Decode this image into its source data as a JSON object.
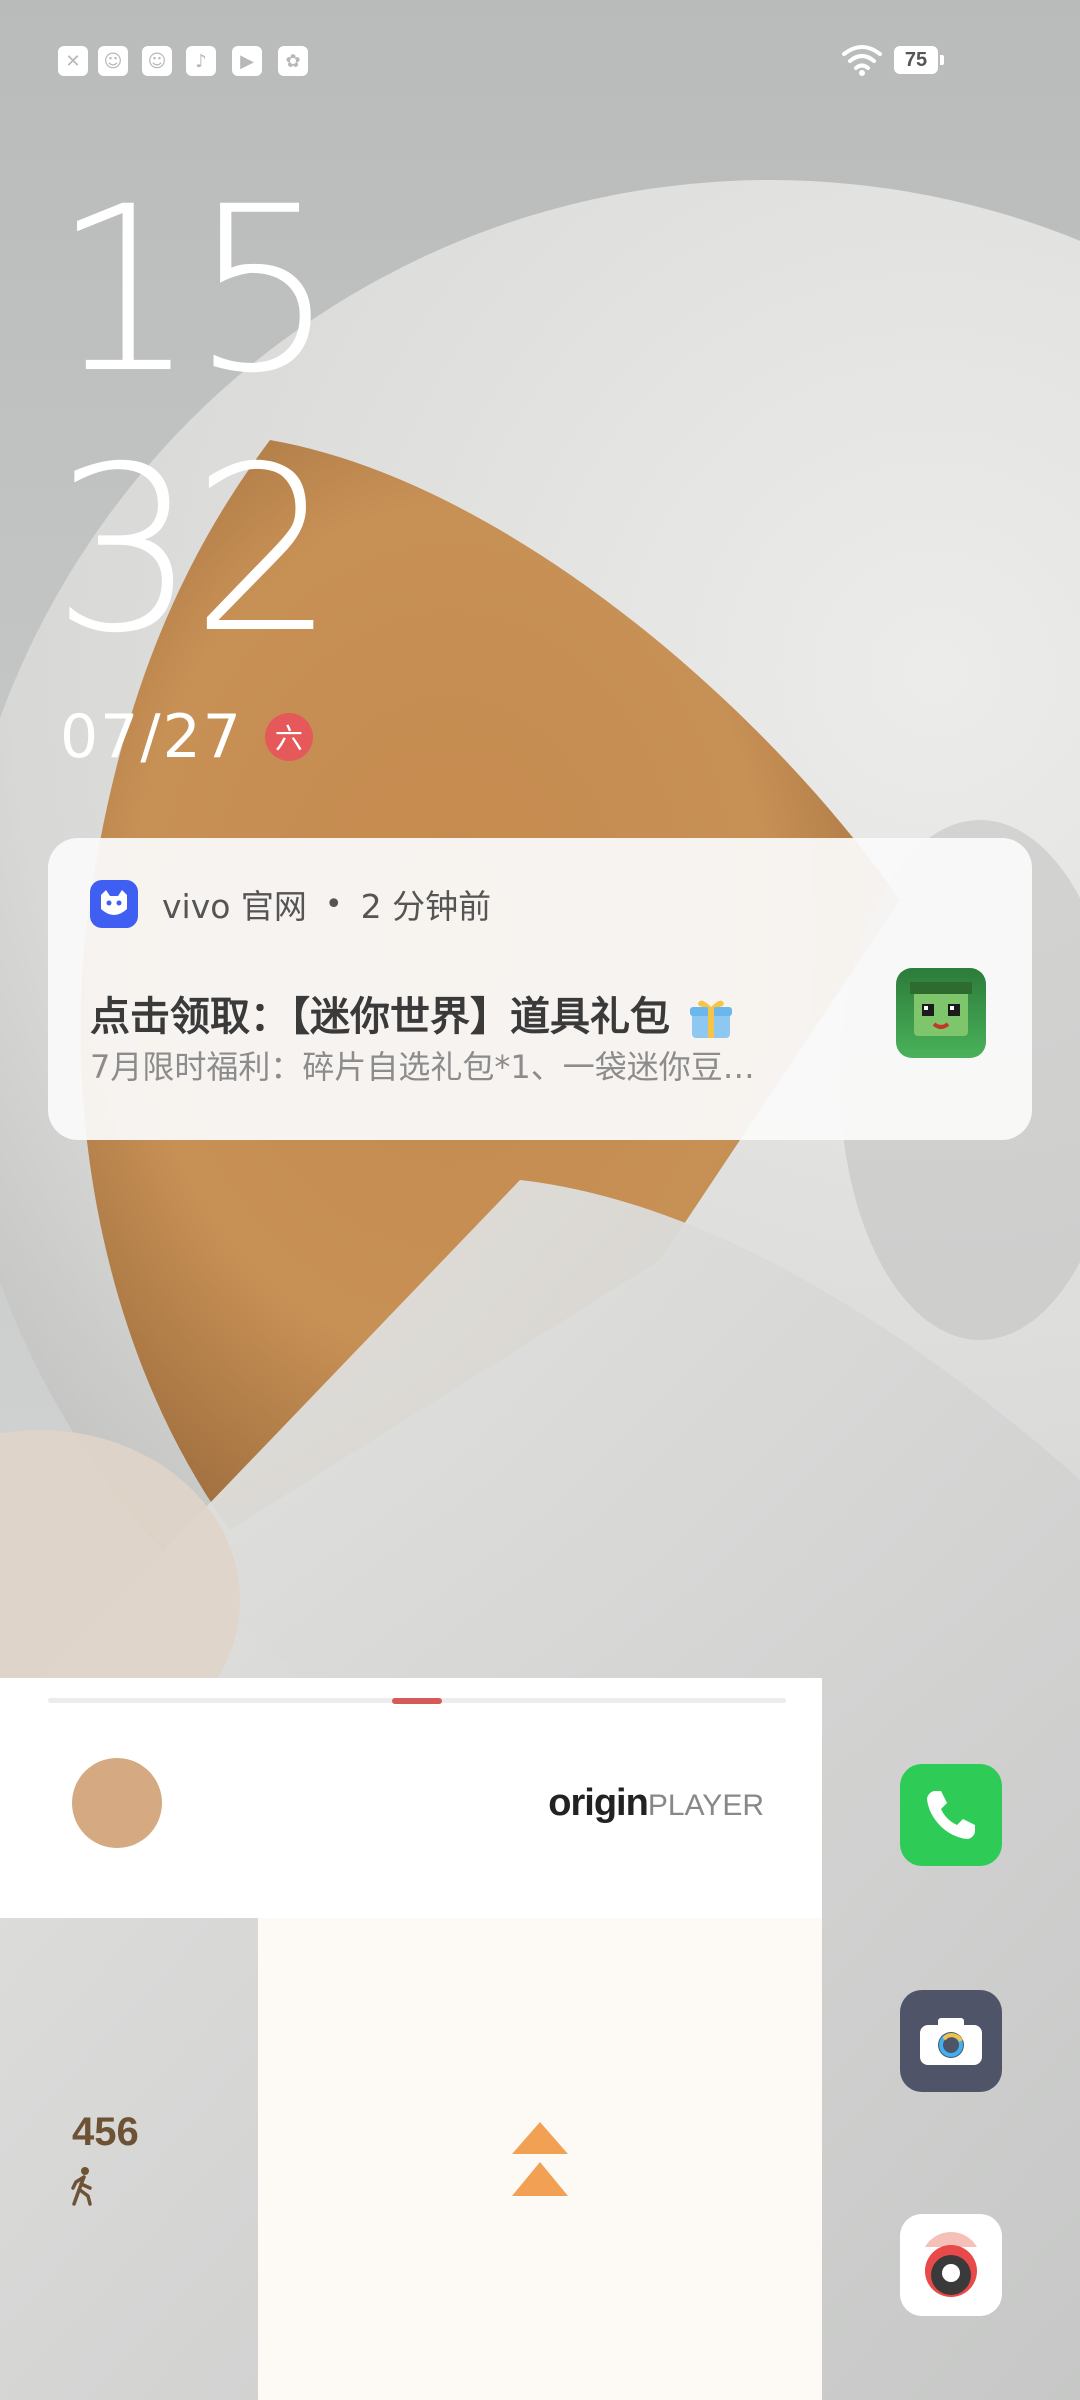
{
  "status_bar": {
    "left_icons": [
      "close-icon",
      "app-mascot-icon",
      "app-mascot-icon",
      "music-note-icon",
      "play-icon",
      "pinwheel-icon"
    ],
    "battery_level": "75"
  },
  "lockscreen": {
    "hour": "15",
    "minute": "32",
    "date": "07/27",
    "weekday": "六"
  },
  "notification": {
    "app_name": "vivo 官网",
    "separator": "•",
    "time_ago": "2 分钟前",
    "title": "点击领取：【迷你世界】道具礼包",
    "body": "7月限时福利：碎片自选礼包*1、一袋迷你豆…"
  },
  "music_player": {
    "brand_main": "origin",
    "brand_sub": "PLAYER",
    "progress_fraction": 0.5
  },
  "steps_widget": {
    "count": "456"
  },
  "dock": {
    "apps": [
      "phone-icon",
      "camera-icon",
      "music-icon"
    ]
  },
  "colors": {
    "accent_red": "#e6595a",
    "phone_green": "#2fcb57",
    "camera_slate": "#4f5468",
    "swipe_orange": "#f2a154",
    "steps_brown": "#6d5235"
  }
}
